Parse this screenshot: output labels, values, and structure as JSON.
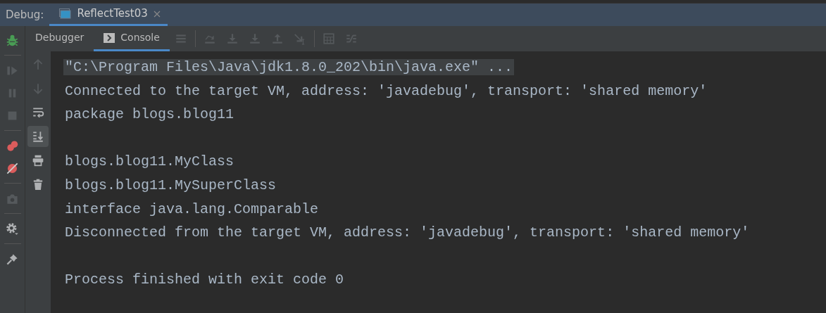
{
  "debug_bar": {
    "label": "Debug:",
    "sessions": [
      {
        "title": "ReflectTest03",
        "selected": true
      }
    ]
  },
  "toolbar": {
    "tabs": [
      {
        "label": "Debugger",
        "selected": false
      },
      {
        "label": "Console",
        "selected": true
      }
    ],
    "buttons": [
      {
        "kind": "menu",
        "disabled": true
      },
      {
        "kind": "sep"
      },
      {
        "kind": "step-over",
        "disabled": true
      },
      {
        "kind": "step-into",
        "disabled": true
      },
      {
        "kind": "force-step-into",
        "disabled": true
      },
      {
        "kind": "step-out",
        "disabled": true
      },
      {
        "kind": "run-to-cursor",
        "disabled": true
      },
      {
        "kind": "sep"
      },
      {
        "kind": "evaluate",
        "disabled": true
      },
      {
        "kind": "trace",
        "disabled": true
      }
    ]
  },
  "left_tools": [
    {
      "kind": "bug",
      "disabled": false
    },
    {
      "kind": "sep"
    },
    {
      "kind": "resume",
      "disabled": true
    },
    {
      "kind": "pause",
      "disabled": true
    },
    {
      "kind": "stop",
      "disabled": true
    },
    {
      "kind": "sep"
    },
    {
      "kind": "breakpoints",
      "disabled": false
    },
    {
      "kind": "mute",
      "disabled": false
    },
    {
      "kind": "sep"
    },
    {
      "kind": "camera",
      "disabled": true
    },
    {
      "kind": "sep"
    },
    {
      "kind": "settings",
      "disabled": false
    },
    {
      "kind": "sep"
    },
    {
      "kind": "pin",
      "disabled": false
    }
  ],
  "console_tools": [
    {
      "kind": "up",
      "disabled": true,
      "toggled": false
    },
    {
      "kind": "down",
      "disabled": true,
      "toggled": false
    },
    {
      "kind": "wrap",
      "disabled": false,
      "toggled": false
    },
    {
      "kind": "scroll-end",
      "disabled": false,
      "toggled": true
    },
    {
      "kind": "print",
      "disabled": false,
      "toggled": false
    },
    {
      "kind": "trash",
      "disabled": false,
      "toggled": false
    }
  ],
  "console": {
    "blocks": [
      [
        {
          "text": "\"C:\\Program Files\\Java\\jdk1.8.0_202\\bin\\java.exe\" ...",
          "highlighted": true
        },
        {
          "text": "Connected to the target VM, address: 'javadebug', transport: 'shared memory'",
          "highlighted": false
        },
        {
          "text": "package blogs.blog11",
          "highlighted": false
        }
      ],
      [
        {
          "text": "blogs.blog11.MyClass",
          "highlighted": false
        },
        {
          "text": "blogs.blog11.MySuperClass",
          "highlighted": false
        },
        {
          "text": "interface java.lang.Comparable",
          "highlighted": false
        },
        {
          "text": "Disconnected from the target VM, address: 'javadebug', transport: 'shared memory'",
          "highlighted": false
        }
      ],
      [
        {
          "text": "Process finished with exit code 0",
          "highlighted": false
        }
      ]
    ]
  }
}
